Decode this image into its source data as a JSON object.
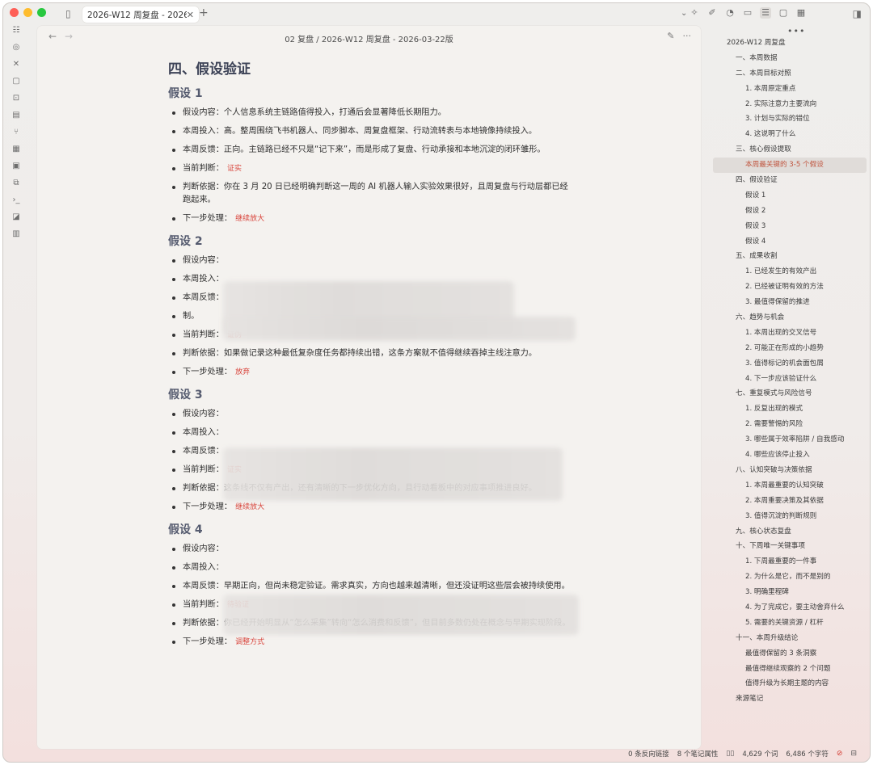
{
  "tab": {
    "title": "2026-W12 周复盘 - 2026...",
    "close": "✕",
    "new": "+"
  },
  "breadcrumb": "02 复盘 / 2026-W12 周复盘 - 2026-03-22版",
  "nav": {
    "back": "←",
    "forward": "→"
  },
  "editor_actions": {
    "edit": "✎",
    "more": "···"
  },
  "doc": {
    "heading": "四、假设验证",
    "sections": [
      {
        "title": "假设 1",
        "items": [
          {
            "text": "假设内容：个人信息系统主链路值得投入，打通后会显著降低长期阻力。"
          },
          {
            "text": "本周投入：高。整周围绕飞书机器人、同步脚本、周复盘框架、行动流转表与本地镜像持续投入。"
          },
          {
            "text": "本周反馈：正向。主链路已经不只是“记下来”，而是形成了复盘、行动承接和本地沉淀的闭环雏形。"
          },
          {
            "text": "当前判断：",
            "tag": "证实"
          },
          {
            "text": "判断依据：你在 3 月 20 日已经明确判断这一周的 AI 机器人输入实验效果很好，且周复盘与行动层都已经跑起来。"
          },
          {
            "text": "下一步处理：",
            "tag": "继续放大"
          }
        ]
      },
      {
        "title": "假设 2",
        "items": [
          {
            "text": "假设内容："
          },
          {
            "text": "本周投入："
          },
          {
            "text": "本周反馈："
          },
          {
            "text": "制。"
          },
          {
            "text": "当前判断：",
            "tag": "证伪"
          },
          {
            "text": "判断依据：如果做记录这种最低复杂度任务都持续出错，这条方案就不值得继续吞掉主线注意力。"
          },
          {
            "text": "下一步处理：",
            "tag": "放弃"
          }
        ]
      },
      {
        "title": "假设 3",
        "items": [
          {
            "text": "假设内容："
          },
          {
            "text": "本周投入："
          },
          {
            "text": "本周反馈："
          },
          {
            "text": "当前判断：",
            "tag": "证实"
          },
          {
            "text": "判断依据：这条线不仅有产出，还有清晰的下一步优化方向，且行动看板中的对应事项推进良好。"
          },
          {
            "text": "下一步处理：",
            "tag": "继续放大"
          }
        ]
      },
      {
        "title": "假设 4",
        "items": [
          {
            "text": "假设内容："
          },
          {
            "text": "本周投入："
          },
          {
            "text": "本周反馈：早期正向，但尚未稳定验证。需求真实，方向也越来越清晰，但还没证明这些层会被持续使用。"
          },
          {
            "text": "当前判断：",
            "tag": "待验证"
          },
          {
            "text": "判断依据：你已经开始明显从“怎么采集”转向“怎么消费和反馈”，但目前多数仍处在概念与早期实现阶段。"
          },
          {
            "text": "下一步处理：",
            "tag": "调整方式"
          }
        ]
      }
    ]
  },
  "outline": {
    "more": "•••",
    "items": [
      {
        "label": "2026-W12 周复盘",
        "level": 0
      },
      {
        "label": "一、本周数据",
        "level": 1
      },
      {
        "label": "二、本周目标对照",
        "level": 1
      },
      {
        "label": "1. 本周原定重点",
        "level": 2
      },
      {
        "label": "2. 实际注意力主要流向",
        "level": 2
      },
      {
        "label": "3. 计划与实际的错位",
        "level": 2
      },
      {
        "label": "4. 这说明了什么",
        "level": 2
      },
      {
        "label": "三、核心假设提取",
        "level": 1
      },
      {
        "label": "本周最关键的 3-5 个假设",
        "level": 2,
        "active": true
      },
      {
        "label": "四、假设验证",
        "level": 1
      },
      {
        "label": "假设 1",
        "level": 2
      },
      {
        "label": "假设 2",
        "level": 2
      },
      {
        "label": "假设 3",
        "level": 2
      },
      {
        "label": "假设 4",
        "level": 2
      },
      {
        "label": "五、成果收割",
        "level": 1
      },
      {
        "label": "1. 已经发生的有效产出",
        "level": 2
      },
      {
        "label": "2. 已经被证明有效的方法",
        "level": 2
      },
      {
        "label": "3. 最值得保留的推进",
        "level": 2
      },
      {
        "label": "六、趋势与机会",
        "level": 1
      },
      {
        "label": "1. 本周出现的交叉信号",
        "level": 2
      },
      {
        "label": "2. 可能正在形成的小趋势",
        "level": 2
      },
      {
        "label": "3. 值得标记的机会面包屑",
        "level": 2
      },
      {
        "label": "4. 下一步应该验证什么",
        "level": 2
      },
      {
        "label": "七、重复模式与风险信号",
        "level": 1
      },
      {
        "label": "1. 反复出现的模式",
        "level": 2
      },
      {
        "label": "2. 需要警惕的风险",
        "level": 2
      },
      {
        "label": "3. 哪些属于效率陷阱 / 自我感动",
        "level": 2
      },
      {
        "label": "4. 哪些应该停止投入",
        "level": 2
      },
      {
        "label": "八、认知突破与决策依据",
        "level": 1
      },
      {
        "label": "1. 本周最重要的认知突破",
        "level": 2
      },
      {
        "label": "2. 本周重要决策及其依据",
        "level": 2
      },
      {
        "label": "3. 值得沉淀的判断规则",
        "level": 2
      },
      {
        "label": "九、核心状态复盘",
        "level": 1
      },
      {
        "label": "十、下周唯一关键事项",
        "level": 1
      },
      {
        "label": "1. 下周最重要的一件事",
        "level": 2
      },
      {
        "label": "2. 为什么是它，而不是别的",
        "level": 2
      },
      {
        "label": "3. 明确里程碑",
        "level": 2
      },
      {
        "label": "4. 为了完成它，要主动舍弃什么",
        "level": 2
      },
      {
        "label": "5. 需要的关键资源 / 杠杆",
        "level": 2
      },
      {
        "label": "十一、本周升级结论",
        "level": 1
      },
      {
        "label": "最值得保留的 3 条洞察",
        "level": 2
      },
      {
        "label": "最值得继续观察的 2 个问题",
        "level": 2
      },
      {
        "label": "值得升级为长期主题的内容",
        "level": 2
      },
      {
        "label": "来源笔记",
        "level": 1
      }
    ]
  },
  "status": {
    "backlinks": "0 条反向链接",
    "properties": "8 个笔记属性",
    "words": "4,629 个词",
    "chars": "6,486 个字符"
  },
  "icons": {
    "ribbon": [
      "files-icon",
      "graph-icon",
      "tools-icon",
      "chat-icon",
      "inbox-icon",
      "document-icon",
      "branch-icon",
      "grid-icon",
      "calendar-icon",
      "copy-icon",
      "terminal-icon",
      "template-icon",
      "layout-icon"
    ],
    "toolbar": [
      "wand-icon",
      "pen-icon",
      "palette-icon",
      "archive-icon",
      "outline-icon",
      "comment-icon",
      "calendar-icon"
    ]
  }
}
